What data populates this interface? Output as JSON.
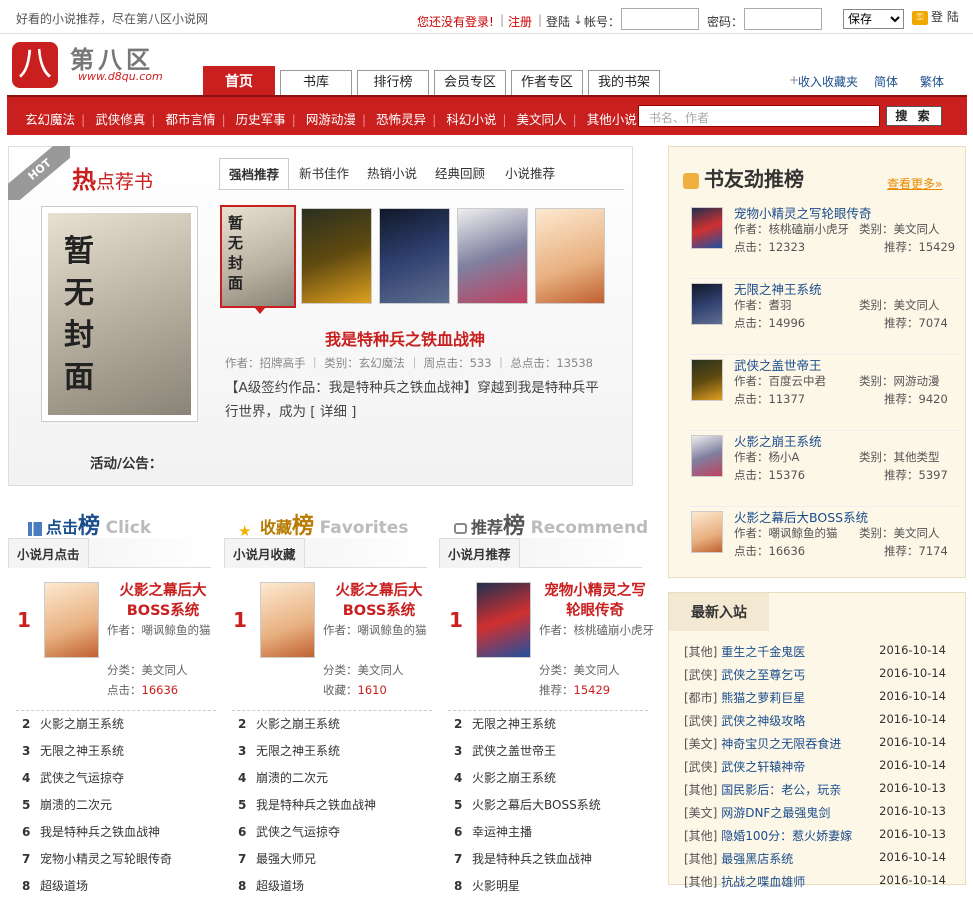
{
  "topbar": {
    "slogan": "好看的小说推荐，尽在第八区小说网",
    "not_logged": "您还没有登录!",
    "register": "注册",
    "login_label": "登陆",
    "account_label": "帐号：",
    "password_label": "密码：",
    "save_option": "保存",
    "login_button": "登 陆"
  },
  "logo": {
    "name": "第八区",
    "url": "www.d8qu.com",
    "mark": "八"
  },
  "tabs": [
    "首页",
    "书库",
    "排行榜",
    "会员专区",
    "作者专区",
    "我的书架"
  ],
  "header_links": {
    "bookmark": "收入收藏夹",
    "simplified": "简体",
    "traditional": "繁体"
  },
  "categories": [
    "玄幻魔法",
    "武侠修真",
    "都市言情",
    "历史军事",
    "网游动漫",
    "恐怖灵异",
    "科幻小说",
    "美文同人",
    "其他小说"
  ],
  "search": {
    "placeholder": "书名、作者",
    "button": "搜 索"
  },
  "hot": {
    "badge": "HOT",
    "title_first": "热",
    "title_rest": "点荐书",
    "tabs": [
      "强档推荐",
      "新书佳作",
      "热销小说",
      "经典回顾",
      "小说推荐"
    ],
    "cover_text": "暂无封面",
    "featured": {
      "title": "我是特种兵之铁血战神",
      "meta": "作者：招牌高手 ｜ 类别：玄幻魔法 ｜ 周点击：533 ｜ 总点击：13538",
      "desc": "【A级签约作品：我是特种兵之铁血战神】穿越到我是特种兵平行世界，成为 [ 详细 ]"
    },
    "notice": "活动/公告："
  },
  "right_rank": {
    "title": "书友劲推榜",
    "more": "查看更多»",
    "items": [
      {
        "name": "宠物小精灵之写轮眼传奇",
        "author": "作者：核桃磕崩小虎牙",
        "cat": "类别：美文同人",
        "click": "点击：12323",
        "rec": "推荐：15429"
      },
      {
        "name": "无限之神王系统",
        "author": "作者：耆羽",
        "cat": "类别：美文同人",
        "click": "点击：14996",
        "rec": "推荐：7074"
      },
      {
        "name": "武侠之盖世帝王",
        "author": "作者：百度云中君",
        "cat": "类别：网游动漫",
        "click": "点击：11377",
        "rec": "推荐：9420"
      },
      {
        "name": "火影之崩王系统",
        "author": "作者：杨小A",
        "cat": "类别：其他类型",
        "click": "点击：15376",
        "rec": "推荐：5397"
      },
      {
        "name": "火影之幕后大BOSS系统",
        "author": "作者：嘲讽鲸鱼的猫",
        "cat": "类别：美文同人",
        "click": "点击：16636",
        "rec": "推荐：7174"
      }
    ]
  },
  "new_entries": {
    "title": "最新入站",
    "rows": [
      {
        "cat": "[其他]",
        "name": "重生之千金鬼医",
        "date": "2016-10-14"
      },
      {
        "cat": "[武侠]",
        "name": "武侠之至尊乞丐",
        "date": "2016-10-14"
      },
      {
        "cat": "[都市]",
        "name": "熊猫之萝莉巨星",
        "date": "2016-10-14"
      },
      {
        "cat": "[武侠]",
        "name": "武侠之神级攻略",
        "date": "2016-10-14"
      },
      {
        "cat": "[美文]",
        "name": "神奇宝贝之无限吞食进",
        "date": "2016-10-14"
      },
      {
        "cat": "[武侠]",
        "name": "武侠之轩辕神帝",
        "date": "2016-10-14"
      },
      {
        "cat": "[其他]",
        "name": "国民影后：老公，玩亲",
        "date": "2016-10-13"
      },
      {
        "cat": "[美文]",
        "name": "网游DNF之最强鬼剑",
        "date": "2016-10-13"
      },
      {
        "cat": "[其他]",
        "name": "隐婚100分：惹火娇妻嫁",
        "date": "2016-10-13"
      },
      {
        "cat": "[其他]",
        "name": "最强黑店系统",
        "date": "2016-10-14"
      },
      {
        "cat": "[其他]",
        "name": "抗战之喋血雄师",
        "date": "2016-10-14"
      }
    ]
  },
  "ranks": [
    {
      "title": "点击",
      "big": "榜",
      "en": "Click",
      "tab": "小说月点击",
      "top": {
        "num": "1",
        "name": "火影之幕后大BOSS系统",
        "author": "作者：嘲讽鲸鱼的猫",
        "cat": "分类：美文同人",
        "stat_label": "点击：",
        "stat": "16636"
      },
      "list": [
        "火影之崩王系统",
        "无限之神王系统",
        "武侠之气运掠夺",
        "崩溃的二次元",
        "我是特种兵之铁血战神",
        "宠物小精灵之写轮眼传奇",
        "超级道场"
      ]
    },
    {
      "title": "收藏",
      "big": "榜",
      "en": "Favorites",
      "tab": "小说月收藏",
      "top": {
        "num": "1",
        "name": "火影之幕后大BOSS系统",
        "author": "作者：嘲讽鲸鱼的猫",
        "cat": "分类：美文同人",
        "stat_label": "收藏：",
        "stat": "1610"
      },
      "list": [
        "火影之崩王系统",
        "无限之神王系统",
        "崩溃的二次元",
        "我是特种兵之铁血战神",
        "武侠之气运掠夺",
        "最强大师兄",
        "超级道场"
      ]
    },
    {
      "title": "推荐",
      "big": "榜",
      "en": "Recommend",
      "tab": "小说月推荐",
      "top": {
        "num": "1",
        "name": "宠物小精灵之写轮眼传奇",
        "author": "作者：核桃磕崩小虎牙",
        "cat": "分类：美文同人",
        "stat_label": "推荐：",
        "stat": "15429"
      },
      "list": [
        "无限之神王系统",
        "武侠之盖世帝王",
        "火影之崩王系统",
        "火影之幕后大BOSS系统",
        "幸运神主播",
        "我是特种兵之铁血战神",
        "火影明星"
      ]
    }
  ]
}
